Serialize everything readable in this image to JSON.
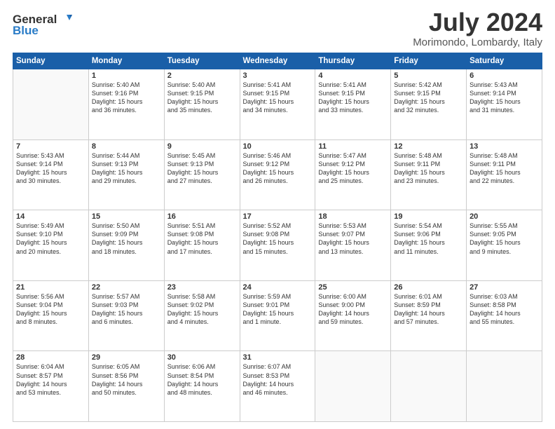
{
  "header": {
    "logo_line1": "General",
    "logo_line2": "Blue",
    "month": "July 2024",
    "location": "Morimondo, Lombardy, Italy"
  },
  "weekdays": [
    "Sunday",
    "Monday",
    "Tuesday",
    "Wednesday",
    "Thursday",
    "Friday",
    "Saturday"
  ],
  "weeks": [
    [
      {
        "day": "",
        "info": ""
      },
      {
        "day": "1",
        "info": "Sunrise: 5:40 AM\nSunset: 9:16 PM\nDaylight: 15 hours\nand 36 minutes."
      },
      {
        "day": "2",
        "info": "Sunrise: 5:40 AM\nSunset: 9:15 PM\nDaylight: 15 hours\nand 35 minutes."
      },
      {
        "day": "3",
        "info": "Sunrise: 5:41 AM\nSunset: 9:15 PM\nDaylight: 15 hours\nand 34 minutes."
      },
      {
        "day": "4",
        "info": "Sunrise: 5:41 AM\nSunset: 9:15 PM\nDaylight: 15 hours\nand 33 minutes."
      },
      {
        "day": "5",
        "info": "Sunrise: 5:42 AM\nSunset: 9:15 PM\nDaylight: 15 hours\nand 32 minutes."
      },
      {
        "day": "6",
        "info": "Sunrise: 5:43 AM\nSunset: 9:14 PM\nDaylight: 15 hours\nand 31 minutes."
      }
    ],
    [
      {
        "day": "7",
        "info": "Sunrise: 5:43 AM\nSunset: 9:14 PM\nDaylight: 15 hours\nand 30 minutes."
      },
      {
        "day": "8",
        "info": "Sunrise: 5:44 AM\nSunset: 9:13 PM\nDaylight: 15 hours\nand 29 minutes."
      },
      {
        "day": "9",
        "info": "Sunrise: 5:45 AM\nSunset: 9:13 PM\nDaylight: 15 hours\nand 27 minutes."
      },
      {
        "day": "10",
        "info": "Sunrise: 5:46 AM\nSunset: 9:12 PM\nDaylight: 15 hours\nand 26 minutes."
      },
      {
        "day": "11",
        "info": "Sunrise: 5:47 AM\nSunset: 9:12 PM\nDaylight: 15 hours\nand 25 minutes."
      },
      {
        "day": "12",
        "info": "Sunrise: 5:48 AM\nSunset: 9:11 PM\nDaylight: 15 hours\nand 23 minutes."
      },
      {
        "day": "13",
        "info": "Sunrise: 5:48 AM\nSunset: 9:11 PM\nDaylight: 15 hours\nand 22 minutes."
      }
    ],
    [
      {
        "day": "14",
        "info": "Sunrise: 5:49 AM\nSunset: 9:10 PM\nDaylight: 15 hours\nand 20 minutes."
      },
      {
        "day": "15",
        "info": "Sunrise: 5:50 AM\nSunset: 9:09 PM\nDaylight: 15 hours\nand 18 minutes."
      },
      {
        "day": "16",
        "info": "Sunrise: 5:51 AM\nSunset: 9:08 PM\nDaylight: 15 hours\nand 17 minutes."
      },
      {
        "day": "17",
        "info": "Sunrise: 5:52 AM\nSunset: 9:08 PM\nDaylight: 15 hours\nand 15 minutes."
      },
      {
        "day": "18",
        "info": "Sunrise: 5:53 AM\nSunset: 9:07 PM\nDaylight: 15 hours\nand 13 minutes."
      },
      {
        "day": "19",
        "info": "Sunrise: 5:54 AM\nSunset: 9:06 PM\nDaylight: 15 hours\nand 11 minutes."
      },
      {
        "day": "20",
        "info": "Sunrise: 5:55 AM\nSunset: 9:05 PM\nDaylight: 15 hours\nand 9 minutes."
      }
    ],
    [
      {
        "day": "21",
        "info": "Sunrise: 5:56 AM\nSunset: 9:04 PM\nDaylight: 15 hours\nand 8 minutes."
      },
      {
        "day": "22",
        "info": "Sunrise: 5:57 AM\nSunset: 9:03 PM\nDaylight: 15 hours\nand 6 minutes."
      },
      {
        "day": "23",
        "info": "Sunrise: 5:58 AM\nSunset: 9:02 PM\nDaylight: 15 hours\nand 4 minutes."
      },
      {
        "day": "24",
        "info": "Sunrise: 5:59 AM\nSunset: 9:01 PM\nDaylight: 15 hours\nand 1 minute."
      },
      {
        "day": "25",
        "info": "Sunrise: 6:00 AM\nSunset: 9:00 PM\nDaylight: 14 hours\nand 59 minutes."
      },
      {
        "day": "26",
        "info": "Sunrise: 6:01 AM\nSunset: 8:59 PM\nDaylight: 14 hours\nand 57 minutes."
      },
      {
        "day": "27",
        "info": "Sunrise: 6:03 AM\nSunset: 8:58 PM\nDaylight: 14 hours\nand 55 minutes."
      }
    ],
    [
      {
        "day": "28",
        "info": "Sunrise: 6:04 AM\nSunset: 8:57 PM\nDaylight: 14 hours\nand 53 minutes."
      },
      {
        "day": "29",
        "info": "Sunrise: 6:05 AM\nSunset: 8:56 PM\nDaylight: 14 hours\nand 50 minutes."
      },
      {
        "day": "30",
        "info": "Sunrise: 6:06 AM\nSunset: 8:54 PM\nDaylight: 14 hours\nand 48 minutes."
      },
      {
        "day": "31",
        "info": "Sunrise: 6:07 AM\nSunset: 8:53 PM\nDaylight: 14 hours\nand 46 minutes."
      },
      {
        "day": "",
        "info": ""
      },
      {
        "day": "",
        "info": ""
      },
      {
        "day": "",
        "info": ""
      }
    ]
  ]
}
